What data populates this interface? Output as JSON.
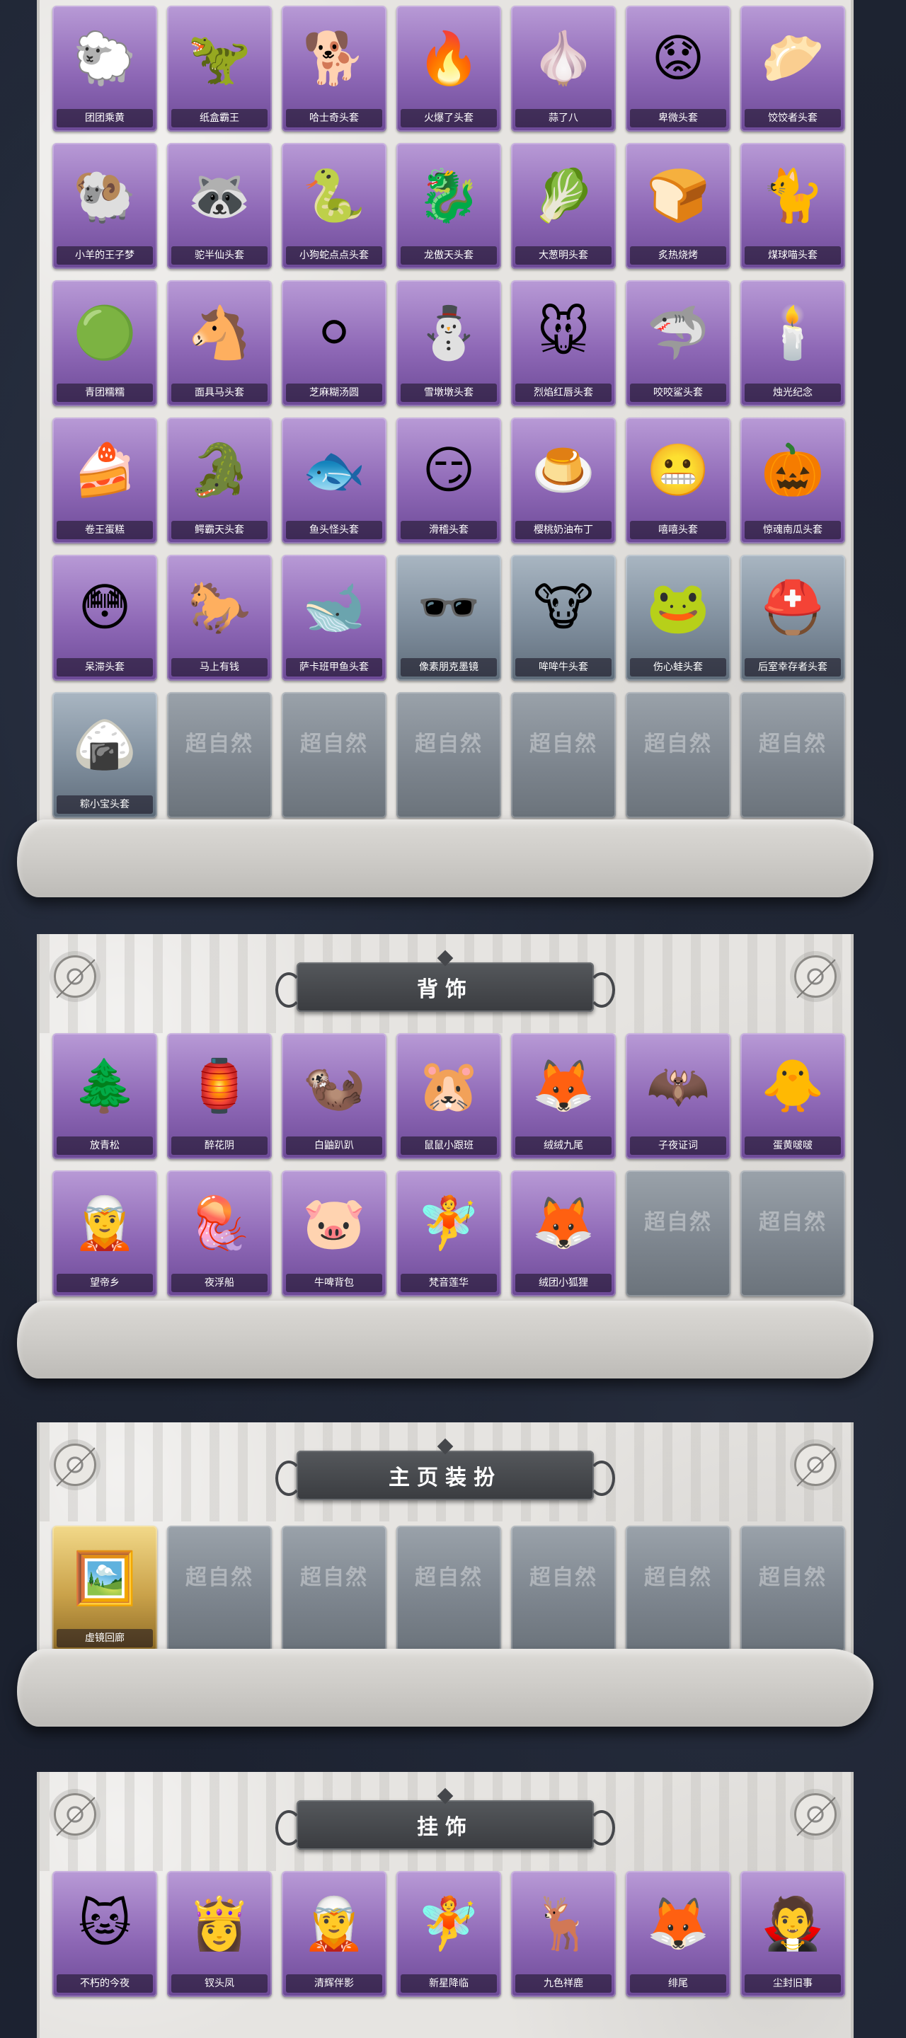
{
  "sections": [
    {
      "id": "head",
      "title": "",
      "items": [
        {
          "name": "团团乘黄",
          "icon": "🐑",
          "tier": "purple"
        },
        {
          "name": "纸盒霸王",
          "icon": "🦖",
          "tier": "purple"
        },
        {
          "name": "哈士奇头套",
          "icon": "🐕",
          "tier": "purple"
        },
        {
          "name": "火爆了头套",
          "icon": "🔥",
          "tier": "purple"
        },
        {
          "name": "蒜了八",
          "icon": "🧄",
          "tier": "purple"
        },
        {
          "name": "卑微头套",
          "icon": "😟",
          "tier": "purple"
        },
        {
          "name": "饺饺者头套",
          "icon": "🥟",
          "tier": "purple"
        },
        {
          "name": "小羊的王子梦",
          "icon": "🐏",
          "tier": "purple"
        },
        {
          "name": "驼半仙头套",
          "icon": "🦝",
          "tier": "purple"
        },
        {
          "name": "小狗蛇点点头套",
          "icon": "🐍",
          "tier": "purple"
        },
        {
          "name": "龙傲天头套",
          "icon": "🐉",
          "tier": "purple"
        },
        {
          "name": "大葱明头套",
          "icon": "🥬",
          "tier": "purple"
        },
        {
          "name": "炙热烧烤",
          "icon": "🍞",
          "tier": "purple"
        },
        {
          "name": "煤球喵头套",
          "icon": "🐈",
          "tier": "purple"
        },
        {
          "name": "青团糯糯",
          "icon": "🟢",
          "tier": "purple"
        },
        {
          "name": "面具马头套",
          "icon": "🐴",
          "tier": "purple"
        },
        {
          "name": "芝麻糊汤圆",
          "icon": "⚪",
          "tier": "purple"
        },
        {
          "name": "雪墩墩头套",
          "icon": "⛄",
          "tier": "purple"
        },
        {
          "name": "烈焰红唇头套",
          "icon": "🐭",
          "tier": "purple"
        },
        {
          "name": "咬咬鲨头套",
          "icon": "🦈",
          "tier": "purple"
        },
        {
          "name": "烛光纪念",
          "icon": "🕯️",
          "tier": "purple"
        },
        {
          "name": "卷王蛋糕",
          "icon": "🍰",
          "tier": "purple"
        },
        {
          "name": "鳄霸天头套",
          "icon": "🐊",
          "tier": "purple"
        },
        {
          "name": "鱼头怪头套",
          "icon": "🐟",
          "tier": "purple"
        },
        {
          "name": "滑稽头套",
          "icon": "😏",
          "tier": "purple"
        },
        {
          "name": "樱桃奶油布丁",
          "icon": "🍮",
          "tier": "purple"
        },
        {
          "name": "嘻嘻头套",
          "icon": "😬",
          "tier": "purple"
        },
        {
          "name": "惊魂南瓜头套",
          "icon": "🎃",
          "tier": "purple"
        },
        {
          "name": "呆滞头套",
          "icon": "😳",
          "tier": "purple"
        },
        {
          "name": "马上有钱",
          "icon": "🐎",
          "tier": "purple"
        },
        {
          "name": "萨卡班甲鱼头套",
          "icon": "🐋",
          "tier": "purple"
        },
        {
          "name": "像素朋克墨镜",
          "icon": "🕶️",
          "tier": "gray"
        },
        {
          "name": "哞哞牛头套",
          "icon": "🐮",
          "tier": "gray"
        },
        {
          "name": "伤心蛙头套",
          "icon": "🐸",
          "tier": "gray"
        },
        {
          "name": "后室幸存者头套",
          "icon": "⛑️",
          "tier": "gray"
        },
        {
          "name": "粽小宝头套",
          "icon": "🍙",
          "tier": "gray"
        },
        {
          "name": "",
          "icon": "超自然",
          "tier": "empty"
        },
        {
          "name": "",
          "icon": "超自然",
          "tier": "empty"
        },
        {
          "name": "",
          "icon": "超自然",
          "tier": "empty"
        },
        {
          "name": "",
          "icon": "超自然",
          "tier": "empty"
        },
        {
          "name": "",
          "icon": "超自然",
          "tier": "empty"
        },
        {
          "name": "",
          "icon": "超自然",
          "tier": "empty"
        }
      ]
    },
    {
      "id": "back",
      "title": "背饰",
      "items": [
        {
          "name": "放青松",
          "icon": "🌲",
          "tier": "purple"
        },
        {
          "name": "醉花阴",
          "icon": "🏮",
          "tier": "purple"
        },
        {
          "name": "白鼬趴趴",
          "icon": "🦦",
          "tier": "purple"
        },
        {
          "name": "鼠鼠小跟班",
          "icon": "🐹",
          "tier": "purple"
        },
        {
          "name": "绒绒九尾",
          "icon": "🦊",
          "tier": "purple"
        },
        {
          "name": "子夜证词",
          "icon": "🦇",
          "tier": "purple"
        },
        {
          "name": "蛋黄啵啵",
          "icon": "🐥",
          "tier": "purple"
        },
        {
          "name": "望帝乡",
          "icon": "🧝",
          "tier": "purple"
        },
        {
          "name": "夜浮船",
          "icon": "🪼",
          "tier": "purple"
        },
        {
          "name": "牛啤背包",
          "icon": "🐷",
          "tier": "purple"
        },
        {
          "name": "梵音莲华",
          "icon": "🧚",
          "tier": "purple"
        },
        {
          "name": "绒团小狐狸",
          "icon": "🦊",
          "tier": "purple"
        },
        {
          "name": "",
          "icon": "超自然",
          "tier": "empty"
        },
        {
          "name": "",
          "icon": "超自然",
          "tier": "empty"
        }
      ]
    },
    {
      "id": "home",
      "title": "主页装扮",
      "items": [
        {
          "name": "虚镜回廊",
          "icon": "🖼️",
          "tier": "gold"
        },
        {
          "name": "",
          "icon": "超自然",
          "tier": "empty"
        },
        {
          "name": "",
          "icon": "超自然",
          "tier": "empty"
        },
        {
          "name": "",
          "icon": "超自然",
          "tier": "empty"
        },
        {
          "name": "",
          "icon": "超自然",
          "tier": "empty"
        },
        {
          "name": "",
          "icon": "超自然",
          "tier": "empty"
        },
        {
          "name": "",
          "icon": "超自然",
          "tier": "empty"
        }
      ]
    },
    {
      "id": "pendant",
      "title": "挂饰",
      "items": [
        {
          "name": "不朽的今夜",
          "icon": "🐱",
          "tier": "purple"
        },
        {
          "name": "钗头凤",
          "icon": "👸",
          "tier": "purple"
        },
        {
          "name": "清辉伴影",
          "icon": "🧝",
          "tier": "purple"
        },
        {
          "name": "新星降临",
          "icon": "🧚",
          "tier": "purple"
        },
        {
          "name": "九色祥鹿",
          "icon": "🦌",
          "tier": "purple"
        },
        {
          "name": "绯尾",
          "icon": "🦊",
          "tier": "purple"
        },
        {
          "name": "尘封旧事",
          "icon": "🧛",
          "tier": "purple"
        }
      ]
    }
  ]
}
